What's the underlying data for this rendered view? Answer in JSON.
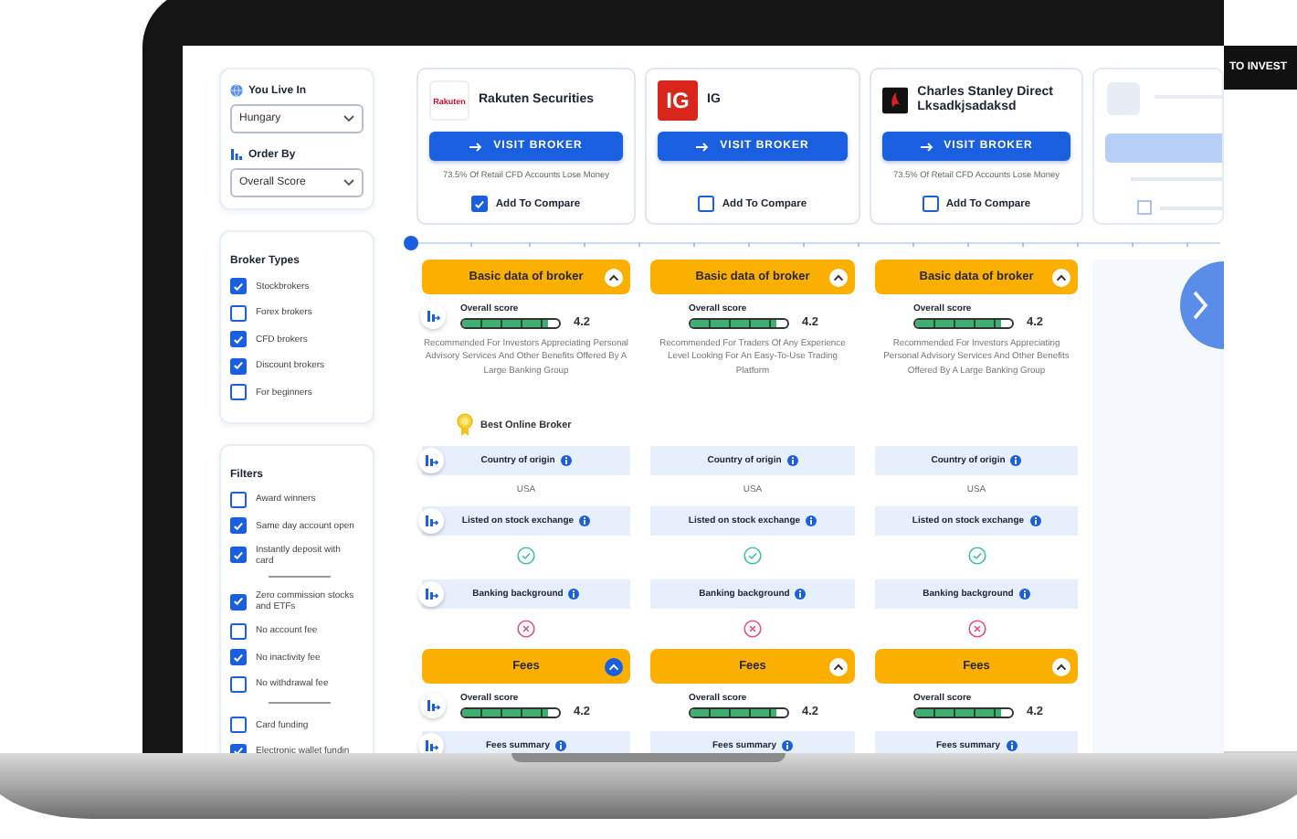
{
  "sidebar": {
    "location": {
      "label": "You Live In",
      "value": "Hungary"
    },
    "order": {
      "label": "Order By",
      "value": "Overall Score"
    },
    "broker_types": {
      "title": "Broker Types",
      "items": [
        {
          "label": "Stockbrokers",
          "checked": true
        },
        {
          "label": "Forex brokers",
          "checked": false
        },
        {
          "label": "CFD brokers",
          "checked": true
        },
        {
          "label": "Discount brokers",
          "checked": true
        },
        {
          "label": "For beginners",
          "checked": false
        }
      ]
    },
    "filters": {
      "title": "Filters",
      "groups": [
        [
          {
            "label": "Award winners",
            "checked": false
          },
          {
            "label": "Same day account open",
            "checked": true
          },
          {
            "label": "Instantly deposit with card",
            "checked": true
          }
        ],
        [
          {
            "label": "Zero commission stocks and ETFs",
            "checked": true
          },
          {
            "label": "No account fee",
            "checked": false
          },
          {
            "label": "No inactivity fee",
            "checked": true
          },
          {
            "label": "No withdrawal fee",
            "checked": false
          }
        ],
        [
          {
            "label": "Card funding",
            "checked": false
          },
          {
            "label": "Electronic wallet fundin",
            "checked": true
          }
        ]
      ]
    }
  },
  "brokers": [
    {
      "kind": "broker",
      "name": "Rakuten Securities",
      "logo": {
        "kind": "wordmark",
        "text": "Rakuten"
      },
      "button": "VISIT BROKER",
      "warning": "73.5% Of Retail CFD Accounts Lose Money",
      "compare_label": "Add To Compare",
      "compare": true
    },
    {
      "kind": "broker",
      "name": "IG",
      "logo": {
        "kind": "tile",
        "text": "IG"
      },
      "button": "VISIT BROKER",
      "compare_label": "Add To Compare",
      "compare": false
    },
    {
      "kind": "broker",
      "name": "Charles Stanley Direct Lksadkjsadaksd",
      "logo": {
        "kind": "emblem"
      },
      "button": "VISIT BROKER",
      "warning": "73.5% Of Retail CFD Accounts Lose Money",
      "compare_label": "Add To Compare",
      "compare": false
    },
    {
      "kind": "placeholder"
    }
  ],
  "comparison": [
    {
      "kind": "section",
      "cells": [
        {
          "title": "Basic data of broker",
          "expanded": true,
          "highlighted": false
        },
        {
          "title": "Basic data of broker",
          "expanded": true,
          "highlighted": false
        },
        {
          "title": "Basic data of broker",
          "expanded": true,
          "highlighted": false
        }
      ]
    },
    {
      "kind": "score",
      "cells": [
        {
          "label": "Overall score",
          "level": 0.88,
          "value": "4.2"
        },
        {
          "label": "Overall score",
          "level": 0.88,
          "value": "4.2"
        },
        {
          "label": "Overall score",
          "level": 0.88,
          "value": "4.2"
        }
      ]
    },
    {
      "kind": "description",
      "cells": [
        {
          "text": "Recommended For Investors Appreciating Personal Advisory Services And Other Benefits Offered By A Large Banking Group"
        },
        {
          "text": "Recommended For Traders Of Any Experience Level Looking For An Easy-To-Use Trading Platform"
        },
        {
          "text": "Recommended For Investors Appreciating Personal Advisory Services And Other Benefits Offered By A Large Banking Group"
        }
      ]
    },
    {
      "kind": "award",
      "cells": [
        {
          "text": "Best Online Broker"
        }
      ]
    },
    {
      "kind": "feature",
      "cells": [
        {
          "label": "Country of origin"
        },
        {
          "label": "Country of origin"
        },
        {
          "label": "Country of origin"
        }
      ]
    },
    {
      "kind": "value",
      "cells": [
        {
          "text": "USA"
        },
        {
          "text": "USA"
        },
        {
          "text": "USA"
        }
      ]
    },
    {
      "kind": "feature",
      "cells": [
        {
          "label": "Listed on stock exchange"
        },
        {
          "label": "Listed on stock exchange"
        },
        {
          "label": "Listed on stock exchange"
        }
      ]
    },
    {
      "kind": "check",
      "cells": [
        {
          "available": true
        },
        {
          "available": true
        },
        {
          "available": true
        }
      ]
    },
    {
      "kind": "feature",
      "cells": [
        {
          "label": "Banking background"
        },
        {
          "label": "Banking background"
        },
        {
          "label": "Banking background"
        }
      ]
    },
    {
      "kind": "check",
      "cells": [
        {
          "available": false
        },
        {
          "available": false
        },
        {
          "available": false
        }
      ]
    },
    {
      "kind": "section",
      "cells": [
        {
          "title": "Fees",
          "expanded": true,
          "highlighted": true
        },
        {
          "title": "Fees",
          "expanded": true,
          "highlighted": false
        },
        {
          "title": "Fees",
          "expanded": true,
          "highlighted": false
        }
      ]
    },
    {
      "kind": "score",
      "cells": [
        {
          "label": "Overall score",
          "level": 0.88,
          "value": "4.2"
        },
        {
          "label": "Overall score",
          "level": 0.88,
          "value": "4.2"
        },
        {
          "label": "Overall score",
          "level": 0.88,
          "value": "4.2"
        }
      ]
    },
    {
      "kind": "feature",
      "cells": [
        {
          "label": "Fees summary"
        },
        {
          "label": "Fees summary"
        },
        {
          "label": "Fees summary"
        }
      ]
    }
  ],
  "side_page": {
    "banner": "TO INVEST"
  }
}
